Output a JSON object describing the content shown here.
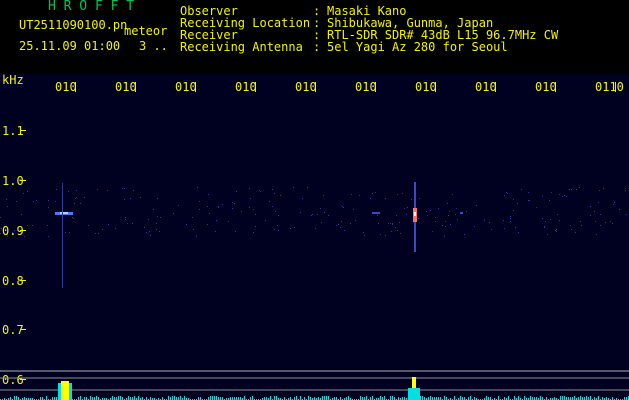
{
  "header": {
    "title": "H R O F F T",
    "filename": "UT2511090100.pn",
    "mode": "meteor",
    "datetime": "25.11.09 01:00",
    "count": "3 ..",
    "info": [
      {
        "label": "Observer",
        "value": "Masaki Kano"
      },
      {
        "label": "Receiving Location",
        "value": "Shibukawa, Gunma, Japan"
      },
      {
        "label": "Receiver",
        "value": "RTL-SDR SDR# 43dB L15 96.7MHz CW"
      },
      {
        "label": "Receiving Antenna",
        "value": "5el Yagi Az 280 for Seoul"
      }
    ],
    "separator": ":"
  },
  "plot": {
    "y_unit": "kHz",
    "y_ticks": [
      "1.1",
      "1.0",
      "0.9",
      "0.8",
      "0.7",
      "0.6"
    ],
    "x_ticks": [
      "010",
      "0102",
      "010:",
      "010.",
      "010́",
      "010̆",
      "0107",
      "010̆",
      "0109",
      "0110"
    ],
    "x_tick_display": [
      "010",
      "010",
      "010",
      "010",
      "010",
      "010",
      "010",
      "010",
      "010",
      "0110"
    ],
    "colors": {
      "background": "#000020",
      "text": "#f2f200",
      "title": "#00c84a",
      "signal": "#4a78ff",
      "hot": "#ff7070",
      "level_cyan": "#00e0e0",
      "level_yellow": "#ffff00",
      "grid_lines": "#b0b0b0"
    }
  }
}
